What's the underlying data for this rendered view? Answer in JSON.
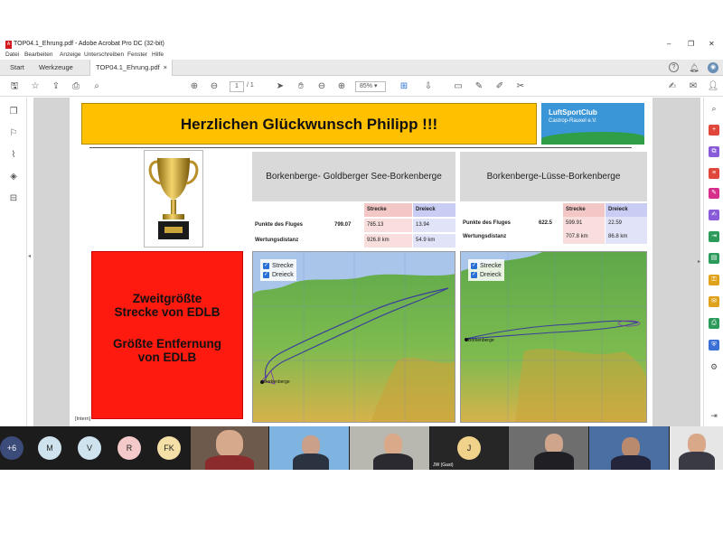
{
  "window": {
    "title": "TOP04.1_Ehrung.pdf - Adobe Acrobat Pro DC (32-bit)",
    "minimize": "–",
    "maximize": "❐",
    "close": "✕"
  },
  "menu": [
    "Datei",
    "Bearbeiten",
    "Anzeige",
    "Unterschreiben",
    "Fenster",
    "Hilfe"
  ],
  "tabs": {
    "start": "Start",
    "tools": "Werkzeuge",
    "document": "TOP04.1_Ehrung.pdf",
    "close": "×"
  },
  "toolbar": {
    "page_current": "1",
    "page_total": "/ 1",
    "zoom": "85%"
  },
  "slide": {
    "headline": "Herzlichen Glückwunsch Philipp !!!",
    "logo_line1": "LuftSportClub",
    "logo_line2": "Castrop-Rauxel e.V.",
    "red_lines": [
      "Zweitgrößte",
      "Strecke von EDLB",
      "",
      "Größte Entfernung",
      "von EDLB"
    ],
    "footer_tag": "[Intern]"
  },
  "routes": [
    {
      "title": "Borkenberge- Goldberger See-Borkenberge",
      "col_strecke": "Strecke",
      "col_dreieck": "Dreieck",
      "row1_label": "Punkte des Fluges",
      "row1_total": "799.07",
      "row1_strecke": "785.13",
      "row1_dreieck": "13.94",
      "row2_label": "Wertungsdistanz",
      "row2_strecke": "926.8 km",
      "row2_dreieck": "54.9 km",
      "legend_strecke": "Strecke",
      "legend_dreieck": "Dreieck",
      "map_label": "Borkenberge"
    },
    {
      "title": "Borkenberge-Lüsse-Borkenberge",
      "col_strecke": "Strecke",
      "col_dreieck": "Dreieck",
      "row1_label": "Punkte des Fluges",
      "row1_total": "622.5",
      "row1_strecke": "599.91",
      "row1_dreieck": "22.59",
      "row2_label": "Wertungsdistanz",
      "row2_strecke": "707.8 km",
      "row2_dreieck": "86.8 km",
      "legend_strecke": "Strecke",
      "legend_dreieck": "Dreieck",
      "map_label": "Borkenberge"
    }
  ],
  "participants": {
    "more": "+6",
    "avatars": [
      {
        "initials": "M",
        "color": "#cfe3ee"
      },
      {
        "initials": "V",
        "color": "#cfe3ee"
      },
      {
        "initials": "R",
        "color": "#f3c9c9"
      },
      {
        "initials": "FK",
        "color": "#f4dfa6"
      },
      {
        "initials": "J",
        "color": "#f1d28a"
      }
    ],
    "tile_label": "JW (Gast)"
  },
  "colors": {
    "headline_bg": "#ffc000",
    "red_box": "#ff1a10",
    "strecke_header": "#f4c7c7",
    "dreieck_header": "#c9cdf3"
  }
}
